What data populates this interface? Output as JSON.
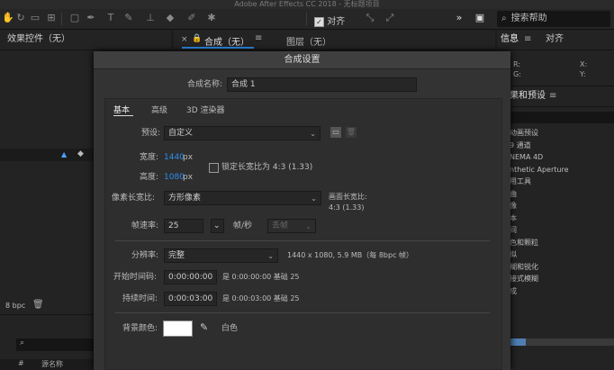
{
  "window": {
    "title": "Adobe After Effects CC 2018 - 无标题项目"
  },
  "toolbar": {
    "snap_label": "对齐",
    "search_placeholder": "搜索帮助"
  },
  "left_panel": {
    "title": "效果控件（无）",
    "bpc": "8 bpc"
  },
  "comp_tabs": {
    "comp_tab": "合成（无）",
    "layer_tab": "图层（无）"
  },
  "info_panel": {
    "info_tab": "信息",
    "align_tab": "对齐",
    "r": "R:",
    "g": "G:",
    "x": "X:",
    "y": "Y:"
  },
  "effects_panel": {
    "title": "果和预设",
    "items": [
      "动画预设",
      "9 通道",
      "NEMA 4D",
      "nthetic Aperture",
      "用工具",
      "曲",
      "像",
      "本",
      "间",
      "色和颗粒",
      "拟",
      "糊和锐化",
      "接式模糊",
      "成"
    ]
  },
  "bottom_left": {
    "column": "源名称"
  },
  "dialog": {
    "title": "合成设置",
    "name_label": "合成名称:",
    "name_value": "合成 1",
    "tabs": [
      "基本",
      "高级",
      "3D 渲染器"
    ],
    "preset_label": "预设:",
    "preset_value": "自定义",
    "width_label": "宽度:",
    "width_value": "1440",
    "height_label": "高度:",
    "height_value": "1080",
    "px": "px",
    "lock_label": "锁定长宽比为 4:3 (1.33)",
    "pixel_aspect_label": "像素长宽比:",
    "pixel_aspect_value": "方形像素",
    "frame_aspect_label": "画面长宽比:",
    "frame_aspect_value": "4:3 (1.33)",
    "fps_label": "帧速率:",
    "fps_value": "25",
    "fps_unit": "帧/秒",
    "drop_frame": "丢帧",
    "resolution_label": "分辨率:",
    "resolution_value": "完整",
    "resolution_info": "1440 x 1080, 5.9 MB（每 8bpc 帧）",
    "start_label": "开始时间码:",
    "start_value": "0:00:00:00",
    "start_info": "是 0:00:00:00 基础 25",
    "duration_label": "持续时间:",
    "duration_value": "0:00:03:00",
    "duration_info": "是 0:00:03:00 基础 25",
    "bg_label": "背景颜色:",
    "bg_name": "白色",
    "bg_color": "#ffffff"
  },
  "colors": {
    "accent": "#2d8ceb"
  }
}
